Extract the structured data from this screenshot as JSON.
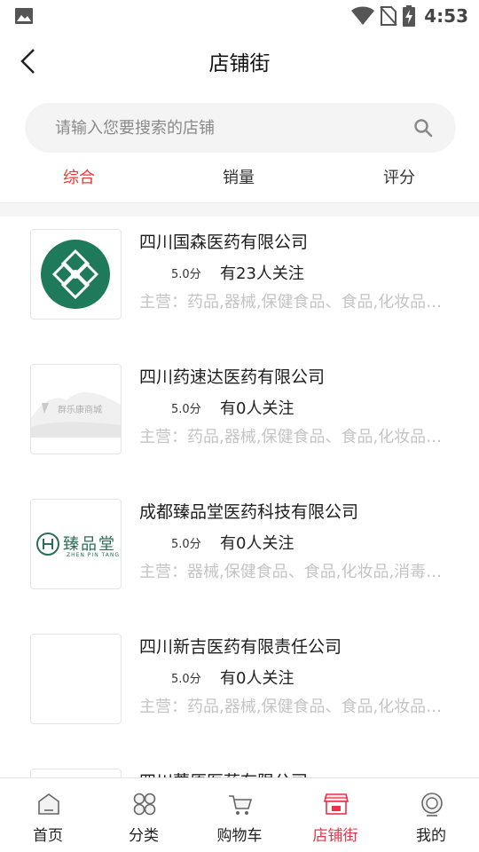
{
  "status_bar": {
    "time": "4:53"
  },
  "header": {
    "title": "店铺街"
  },
  "search": {
    "placeholder": "请输入您要搜索的店铺",
    "value": ""
  },
  "sort_tabs": [
    {
      "label": "综合",
      "active": true
    },
    {
      "label": "销量",
      "active": false
    },
    {
      "label": "评分",
      "active": false
    }
  ],
  "shops": [
    {
      "name": "四川国森医药有限公司",
      "rating": "5.0分",
      "followers": "有23人关注",
      "main_business": "主营：药品,器械,保健食品、食品,化妆品、消毒用品",
      "logo": "guosen-logo"
    },
    {
      "name": "四川药速达医药有限公司",
      "rating": "5.0分",
      "followers": "有0人关注",
      "main_business": "主营：药品,器械,保健食品、食品,化妆品、消毒用品",
      "logo": "qunlekang-logo",
      "logo_text": "群乐康商城"
    },
    {
      "name": "成都臻品堂医药科技有限公司",
      "rating": "5.0分",
      "followers": "有0人关注",
      "main_business": "主营：器械,保健食品、食品,化妆品,消毒用品",
      "logo": "zhenpintang-logo",
      "logo_text": "臻品堂",
      "logo_subtext": "ZHEN PIN TANG"
    },
    {
      "name": "四川新吉医药有限责任公司",
      "rating": "5.0分",
      "followers": "有0人关注",
      "main_business": "主营：药品,器械,保健食品、食品,化妆品、消毒用品",
      "logo": "empty-logo"
    },
    {
      "name": "四川蕙原医药有限公司",
      "rating": "",
      "followers": "",
      "main_business": "",
      "logo": "empty-logo"
    }
  ],
  "tabbar": [
    {
      "label": "首页",
      "icon": "home-icon",
      "active": false
    },
    {
      "label": "分类",
      "icon": "category-icon",
      "active": false
    },
    {
      "label": "购物车",
      "icon": "cart-icon",
      "active": false
    },
    {
      "label": "店铺街",
      "icon": "store-icon",
      "active": true
    },
    {
      "label": "我的",
      "icon": "profile-icon",
      "active": false
    }
  ],
  "colors": {
    "accent": "#e83a3a",
    "tab_active": "#e8334a",
    "guosen_green": "#1e7a5a",
    "zhenpintang_green": "#2a6e58"
  }
}
